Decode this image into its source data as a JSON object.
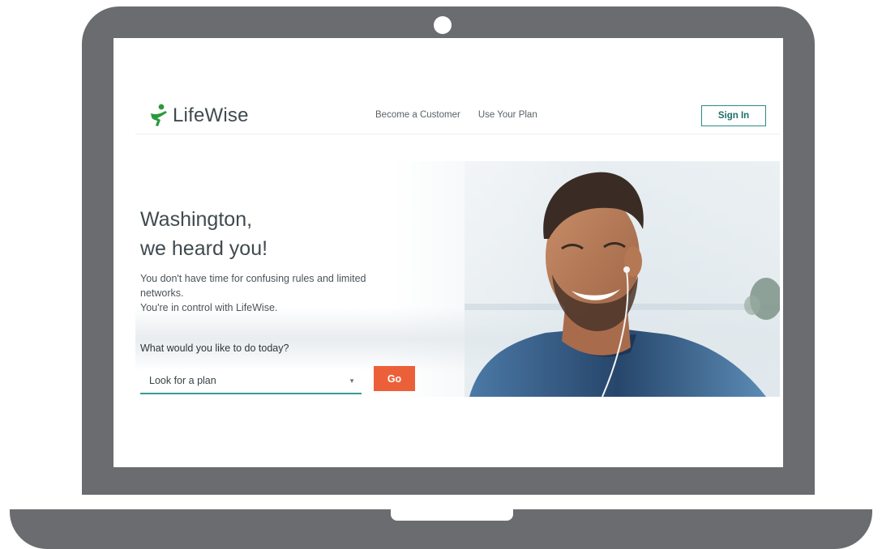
{
  "site": {
    "brand": "LifeWise",
    "nav": [
      "Become a Customer",
      "Use Your Plan"
    ],
    "sign_in": "Sign In"
  },
  "hero": {
    "headline_line1": "Washington,",
    "headline_line2": "we heard you!",
    "subtext_line1": "You don't have time for confusing rules and limited",
    "subtext_line2": "networks.",
    "subtext_line3": "You're in control with LifeWise.",
    "question": "What would you like to do today?",
    "select_value": "Look for a plan",
    "go_label": "Go"
  },
  "colors": {
    "laptop_frame": "#6a6c6f",
    "brand_green": "#2b9a3d",
    "accent_teal": "#2a8b84",
    "cta_orange": "#ec6039",
    "text_dark": "#404a4e"
  },
  "icons": {
    "logo": "leaping-figure-logo-icon",
    "select": "caret-down-icon"
  }
}
